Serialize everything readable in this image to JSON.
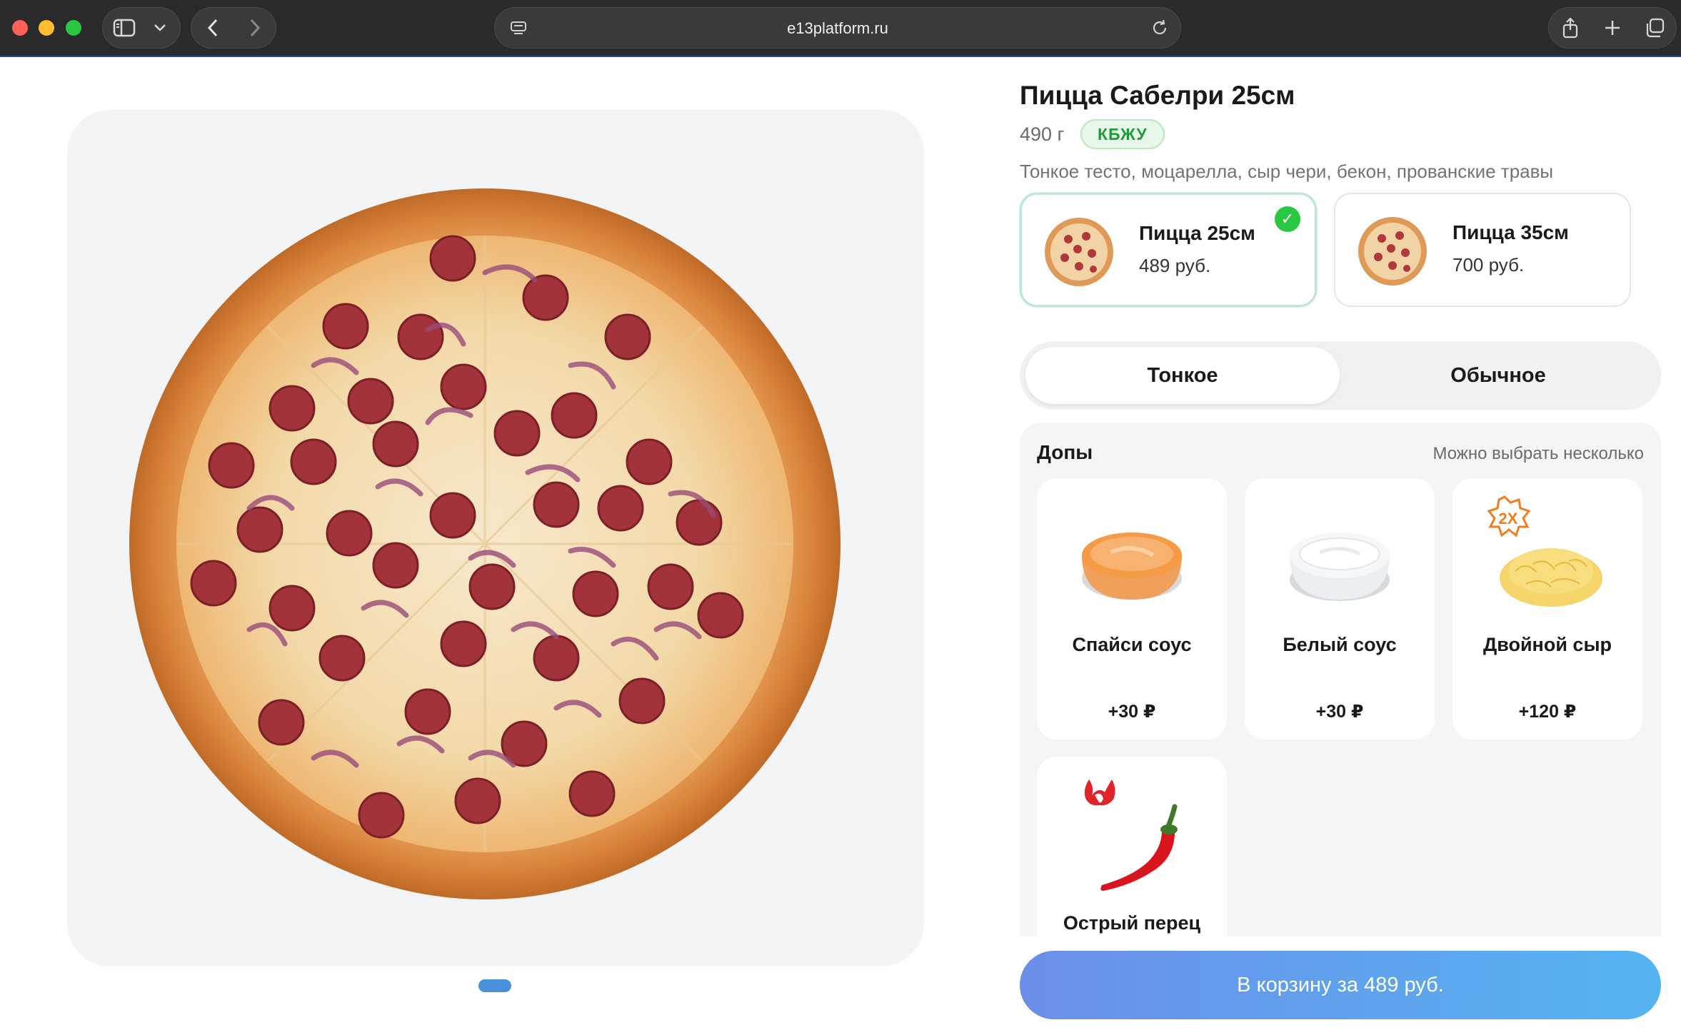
{
  "browser": {
    "url": "e13platform.ru"
  },
  "product": {
    "title": "Пицца Сабелри 25см",
    "weight": "490 г",
    "nutrition_badge": "КБЖУ",
    "description": "Тонкое тесто, моцарелла, сыр чери, бекон, прованские травы"
  },
  "sizes": [
    {
      "name": "Пицца 25см",
      "price": "489 руб.",
      "selected": true
    },
    {
      "name": "Пицца 35см",
      "price": "700 руб.",
      "selected": false
    }
  ],
  "dough": {
    "options": [
      "Тонкое",
      "Обычное"
    ],
    "selected": "Тонкое"
  },
  "addons": {
    "title": "Допы",
    "hint": "Можно выбрать несколько",
    "items": [
      {
        "name": "Спайси соус",
        "price": "+30 ₽",
        "icon": "spicy-sauce"
      },
      {
        "name": "Белый соус",
        "price": "+30 ₽",
        "icon": "white-sauce"
      },
      {
        "name": "Двойной сыр",
        "price": "+120 ₽",
        "icon": "double-cheese",
        "badge": "2X"
      },
      {
        "name": "Острый перец",
        "price": "",
        "icon": "chili-pepper"
      }
    ]
  },
  "cart_button": "В корзину за 489 руб.",
  "colors": {
    "accent_blue_start": "#6b8ee9",
    "accent_blue_end": "#55b4f0",
    "selected_border": "#bfe6dc",
    "check_green": "#28c840",
    "badge_green": "#1f9b3a"
  }
}
